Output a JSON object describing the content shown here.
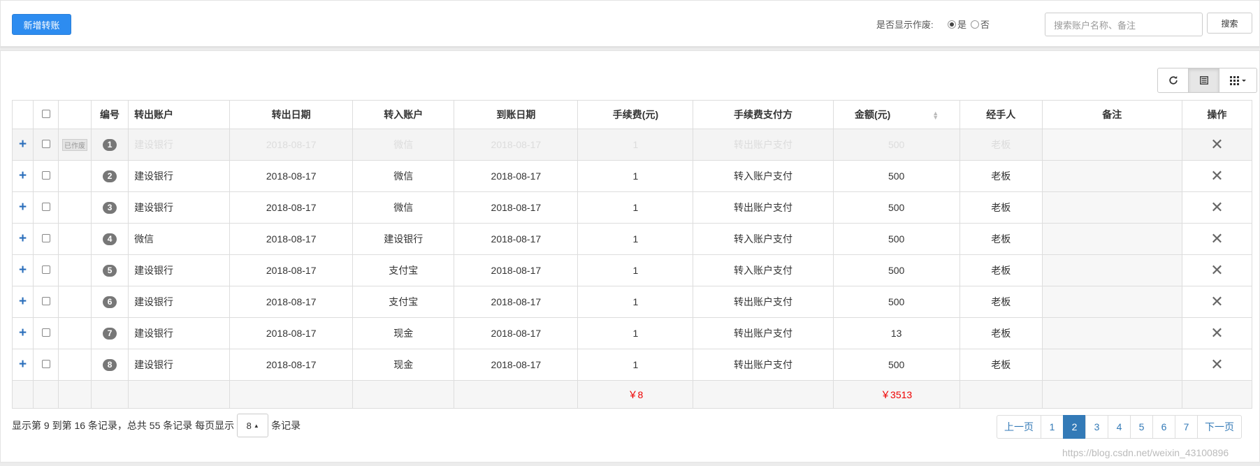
{
  "header": {
    "add_button": "新增转账",
    "void_label": "是否显示作废:",
    "radio_yes": "是",
    "radio_no": "否",
    "search_placeholder": "搜索账户名称、备注",
    "search_button": "搜索"
  },
  "toolbar": {
    "refresh_icon": "refresh-icon",
    "list_icon": "list-view-icon",
    "columns_icon": "columns-grid-icon"
  },
  "table": {
    "columns": [
      "编号",
      "转出账户",
      "转出日期",
      "转入账户",
      "到账日期",
      "手续费(元)",
      "手续费支付方",
      "金额(元)",
      "经手人",
      "备注",
      "操作"
    ],
    "rows": [
      {
        "no": "1",
        "void_tag": "已作废",
        "from": "建设银行",
        "out_date": "2018-08-17",
        "to": "微信",
        "arrive_date": "2018-08-17",
        "fee": "1",
        "payer": "转出账户支付",
        "amount": "500",
        "handler": "老板",
        "note": ""
      },
      {
        "no": "2",
        "void_tag": "",
        "from": "建设银行",
        "out_date": "2018-08-17",
        "to": "微信",
        "arrive_date": "2018-08-17",
        "fee": "1",
        "payer": "转入账户支付",
        "amount": "500",
        "handler": "老板",
        "note": ""
      },
      {
        "no": "3",
        "void_tag": "",
        "from": "建设银行",
        "out_date": "2018-08-17",
        "to": "微信",
        "arrive_date": "2018-08-17",
        "fee": "1",
        "payer": "转出账户支付",
        "amount": "500",
        "handler": "老板",
        "note": ""
      },
      {
        "no": "4",
        "void_tag": "",
        "from": "微信",
        "out_date": "2018-08-17",
        "to": "建设银行",
        "arrive_date": "2018-08-17",
        "fee": "1",
        "payer": "转入账户支付",
        "amount": "500",
        "handler": "老板",
        "note": ""
      },
      {
        "no": "5",
        "void_tag": "",
        "from": "建设银行",
        "out_date": "2018-08-17",
        "to": "支付宝",
        "arrive_date": "2018-08-17",
        "fee": "1",
        "payer": "转入账户支付",
        "amount": "500",
        "handler": "老板",
        "note": ""
      },
      {
        "no": "6",
        "void_tag": "",
        "from": "建设银行",
        "out_date": "2018-08-17",
        "to": "支付宝",
        "arrive_date": "2018-08-17",
        "fee": "1",
        "payer": "转出账户支付",
        "amount": "500",
        "handler": "老板",
        "note": ""
      },
      {
        "no": "7",
        "void_tag": "",
        "from": "建设银行",
        "out_date": "2018-08-17",
        "to": "现金",
        "arrive_date": "2018-08-17",
        "fee": "1",
        "payer": "转出账户支付",
        "amount": "13",
        "handler": "老板",
        "note": ""
      },
      {
        "no": "8",
        "void_tag": "",
        "from": "建设银行",
        "out_date": "2018-08-17",
        "to": "现金",
        "arrive_date": "2018-08-17",
        "fee": "1",
        "payer": "转出账户支付",
        "amount": "500",
        "handler": "老板",
        "note": ""
      }
    ],
    "footer": {
      "fee_total": "￥8",
      "amount_total": "￥3513"
    }
  },
  "pager": {
    "info": "显示第 9 到第 16 条记录，总共 55 条记录 每页显示",
    "page_size": "8",
    "suffix": "条记录",
    "prev": "上一页",
    "next": "下一页",
    "pages": [
      "1",
      "2",
      "3",
      "4",
      "5",
      "6",
      "7"
    ],
    "current": "2"
  },
  "watermark": "https://blog.csdn.net/weixin_43100896"
}
